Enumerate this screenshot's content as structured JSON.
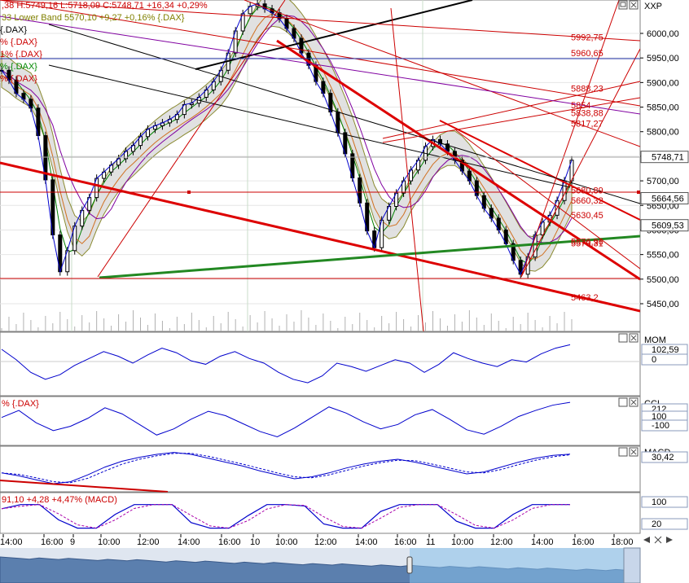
{
  "header": {
    "price_line": ",38 H:5749,16 L:5718,09 C:5748,71 +16,34 +0,29%",
    "bb_line": "33 Lower Band 5570,10 +9,27 +0,16% {.DAX}",
    "legend_partials": [
      {
        "text": "{.DAX}",
        "color": "#000000"
      },
      {
        "text": "% {.DAX}",
        "color": "#cc0000"
      },
      {
        "text": "1% {.DAX}",
        "color": "#cc0000"
      },
      {
        "text": "% {.DAX}",
        "color": "#008800"
      },
      {
        "text": "% {.DAX}",
        "color": "#cc0000"
      }
    ]
  },
  "panels": {
    "main": {
      "tag": "XXP"
    },
    "mom": {
      "tag": "MOM",
      "labels": [
        "102,59",
        "0"
      ]
    },
    "cci": {
      "tag": "CCI",
      "header": "% {.DAX}",
      "labels": [
        "212",
        "100",
        "-100"
      ]
    },
    "macd": {
      "tag": "MACD",
      "labels": [
        "30,42"
      ]
    },
    "stoch": {
      "tag": "",
      "header": "91,10 +4,28 +4,47% (MACD)",
      "labels": [
        "100",
        "20"
      ]
    }
  },
  "icons": [
    "restore-window-icon",
    "close-icon",
    "scroll-left-icon",
    "zoom-icon",
    "scroll-right-icon"
  ],
  "chart_data": {
    "type": "line",
    "instrument": "{.DAX}",
    "ohlc_last": {
      "high": 5749.16,
      "low": 5718.09,
      "close": 5748.71,
      "change": 16.34,
      "change_pct": 0.29
    },
    "y_axis_ticks": [
      "6000,00",
      "5950,00",
      "5900,00",
      "5850,00",
      "5800,00",
      "5750,00",
      "5700,00",
      "5650,00",
      "5600,00",
      "5550,00",
      "5500,00",
      "5450,00"
    ],
    "ylim": [
      5412,
      6068
    ],
    "price_badges": [
      {
        "label": "5748,71",
        "value": 5748.71
      },
      {
        "label": "5664,56",
        "value": 5664.56
      },
      {
        "label": "5609,53",
        "value": 5609.53
      }
    ],
    "level_labels": [
      {
        "label": "5992,75",
        "value": 5992.75
      },
      {
        "label": "5960,65",
        "value": 5960.65
      },
      {
        "label": "5888,23",
        "value": 5888.23
      },
      {
        "label": "5854",
        "value": 5854
      },
      {
        "label": "5838,88",
        "value": 5838.88
      },
      {
        "label": "5817,27",
        "value": 5817.27
      },
      {
        "label": "5680,89",
        "value": 5680.89
      },
      {
        "label": "5660,32",
        "value": 5660.32
      },
      {
        "label": "5630,45",
        "value": 5630.45
      },
      {
        "label": "5573,31",
        "value": 5573.31
      },
      {
        "label": "5576,96",
        "value": 5576.96
      },
      {
        "label": "5463,2",
        "value": 5463.2
      }
    ],
    "time_ticks": [
      "14:00",
      "16:00",
      "9",
      "10:00",
      "12:00",
      "14:00",
      "16:00",
      "10",
      "10:00",
      "12:00",
      "14:00",
      "16:00",
      "11",
      "10:00",
      "12:00",
      "14:00",
      "16:00",
      "18:00"
    ],
    "close_series": [
      5925,
      5905,
      5878,
      5866,
      5848,
      5792,
      5702,
      5590,
      5515,
      5558,
      5608,
      5640,
      5666,
      5705,
      5718,
      5732,
      5745,
      5760,
      5772,
      5790,
      5805,
      5812,
      5818,
      5825,
      5835,
      5855,
      5858,
      5870,
      5885,
      5902,
      5925,
      5960,
      6005,
      6040,
      6055,
      6060,
      6050,
      6042,
      6030,
      6010,
      5990,
      5960,
      5935,
      5902,
      5878,
      5840,
      5798,
      5755,
      5706,
      5655,
      5598,
      5564,
      5620,
      5648,
      5675,
      5700,
      5722,
      5742,
      5770,
      5784,
      5775,
      5760,
      5742,
      5720,
      5700,
      5670,
      5644,
      5624,
      5600,
      5572,
      5538,
      5510,
      5545,
      5590,
      5616,
      5630,
      5660,
      5700,
      5742
    ],
    "mom_series": [
      101.8,
      100.9,
      99.8,
      99.2,
      99.6,
      100.4,
      101.0,
      101.6,
      101.2,
      100.6,
      101.3,
      101.9,
      101.5,
      100.8,
      100.5,
      101.2,
      101.6,
      101.0,
      100.6,
      99.8,
      99.2,
      98.9,
      99.5,
      100.6,
      100.3,
      99.9,
      100.4,
      100.9,
      100.6,
      99.8,
      100.5,
      101.5,
      101.0,
      100.6,
      100.3,
      100.9,
      100.7,
      101.4,
      101.9,
      102.2
    ],
    "cci_series": [
      40,
      120,
      -20,
      -110,
      -60,
      30,
      150,
      80,
      -40,
      -160,
      -90,
      20,
      110,
      60,
      -30,
      -120,
      -180,
      -80,
      40,
      160,
      90,
      -10,
      -90,
      -40,
      70,
      130,
      20,
      -100,
      -150,
      -60,
      50,
      120,
      180,
      212
    ],
    "macd_series": [
      -8,
      -14,
      -22,
      -30,
      -26,
      -12,
      4,
      16,
      24,
      30,
      34,
      30,
      22,
      14,
      6,
      -4,
      -12,
      -20,
      -16,
      -8,
      2,
      10,
      16,
      20,
      14,
      6,
      -2,
      -10,
      -6,
      4,
      14,
      22,
      28,
      30.42
    ],
    "stoch_series": [
      80,
      95,
      95,
      40,
      10,
      10,
      60,
      95,
      95,
      95,
      30,
      10,
      10,
      55,
      95,
      95,
      90,
      25,
      10,
      10,
      70,
      95,
      95,
      95,
      35,
      10,
      10,
      60,
      95,
      95,
      95
    ]
  }
}
